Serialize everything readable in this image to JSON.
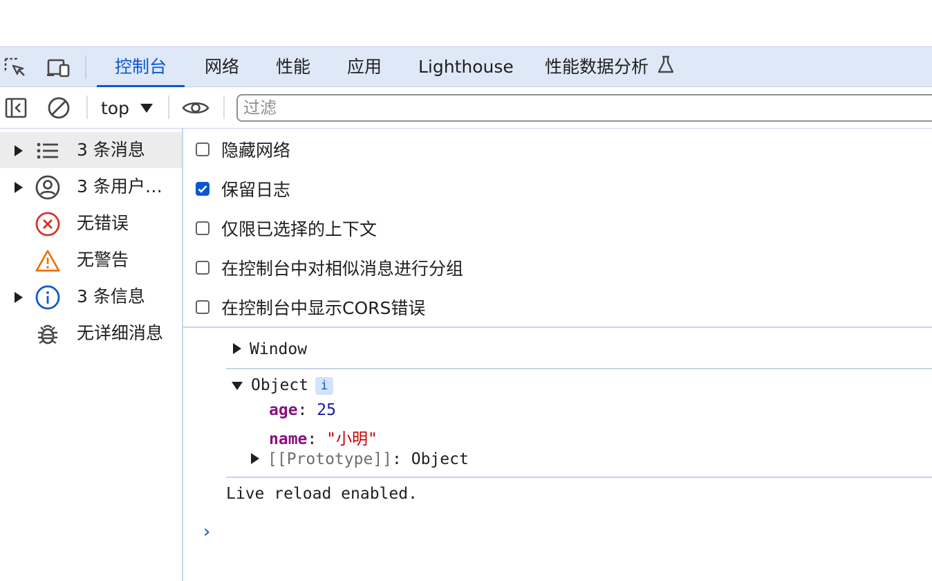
{
  "tabs": [
    {
      "label": "控制台",
      "active": true
    },
    {
      "label": "网络",
      "active": false
    },
    {
      "label": "性能",
      "active": false
    },
    {
      "label": "应用",
      "active": false
    },
    {
      "label": "Lighthouse",
      "active": false
    },
    {
      "label": "性能数据分析",
      "active": false,
      "icon": "flask-icon"
    }
  ],
  "toolbar": {
    "context": "top",
    "filter_placeholder": "过滤",
    "filter_value": ""
  },
  "sidebar": {
    "items": [
      {
        "label": "3 条消息",
        "icon": "list-icon",
        "expandable": true,
        "selected": true
      },
      {
        "label": "3 条用户…",
        "icon": "user-circle-icon",
        "expandable": true,
        "selected": false
      },
      {
        "label": "无错误",
        "icon": "error-circle-icon",
        "expandable": false,
        "selected": false
      },
      {
        "label": "无警告",
        "icon": "warning-triangle-icon",
        "expandable": false,
        "selected": false
      },
      {
        "label": "3 条信息",
        "icon": "info-circle-icon",
        "expandable": true,
        "selected": false
      },
      {
        "label": "无详细消息",
        "icon": "bug-icon",
        "expandable": false,
        "selected": false
      }
    ]
  },
  "settings": [
    {
      "label": "隐藏网络",
      "checked": false
    },
    {
      "label": "保留日志",
      "checked": true
    },
    {
      "label": "仅限已选择的上下文",
      "checked": false
    },
    {
      "label": "在控制台中对相似消息进行分组",
      "checked": false
    },
    {
      "label": "在控制台中显示CORS错误",
      "checked": false
    }
  ],
  "console": {
    "window_label": "Window",
    "object_label": "Object",
    "info_badge": "i",
    "props": [
      {
        "key": "age",
        "sep": ": ",
        "value": "25"
      },
      {
        "key": "name",
        "sep": ": ",
        "value": "\"小明\""
      }
    ],
    "prototype_key": "[[Prototype]]",
    "prototype_sep": ": ",
    "prototype_value": "Object",
    "log_line": "Live reload enabled.",
    "prompt": "›"
  },
  "colors": {
    "accent": "#0b57d0",
    "tabbar_bg": "#dfe8f7",
    "error": "#d93025",
    "warning": "#e8710a",
    "key": "#881280",
    "string": "#c80000",
    "number": "#1a1aa6"
  }
}
